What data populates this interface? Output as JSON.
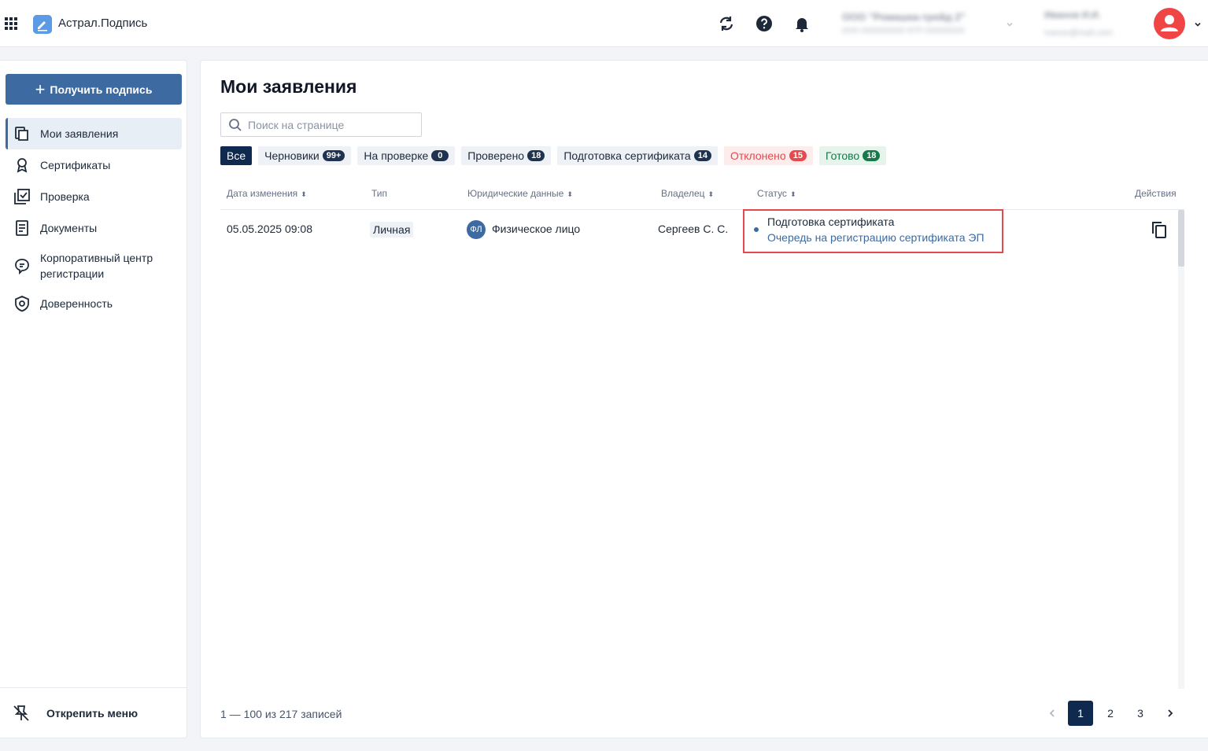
{
  "app": {
    "title": "Астрал.Подпись"
  },
  "header": {
    "org_name": "ООО \"Ромашка-трейд 2\"",
    "org_details": "ИНН 0000000000 КПП 000000000",
    "user_name": "Иванов И.И.",
    "user_email": "ivanov@mail.com",
    "icons": [
      "refresh-icon",
      "help-icon",
      "bell-icon"
    ]
  },
  "sidebar": {
    "get_sign_label": "Получить подпись",
    "items": [
      {
        "label": "Мои заявления",
        "icon": "documents-copy-icon",
        "active": true
      },
      {
        "label": "Сертификаты",
        "icon": "certificate-icon",
        "active": false
      },
      {
        "label": "Проверка",
        "icon": "check-icon",
        "active": false
      },
      {
        "label": "Документы",
        "icon": "document-icon",
        "active": false
      },
      {
        "label": "Корпоративный центр регистрации",
        "icon": "chat-icon",
        "active": false
      },
      {
        "label": "Доверенность",
        "icon": "shield-icon",
        "active": false
      }
    ],
    "unpin_label": "Открепить меню"
  },
  "main": {
    "title": "Мои заявления",
    "search_placeholder": "Поиск на странице",
    "filters": [
      {
        "label": "Все",
        "count": null,
        "style": "active"
      },
      {
        "label": "Черновики",
        "count": "99+",
        "style": "default"
      },
      {
        "label": "На проверке",
        "count": "0",
        "style": "default"
      },
      {
        "label": "Проверено",
        "count": "18",
        "style": "default"
      },
      {
        "label": "Подготовка сертификата",
        "count": "14",
        "style": "default"
      },
      {
        "label": "Отклонено",
        "count": "15",
        "style": "red"
      },
      {
        "label": "Готово",
        "count": "18",
        "style": "green"
      }
    ],
    "columns": {
      "date": "Дата изменения",
      "type": "Тип",
      "legal": "Юридические данные",
      "owner": "Владелец",
      "status": "Статус",
      "actions": "Действия"
    },
    "rows": [
      {
        "date": "05.05.2025 09:08",
        "type": "Личная",
        "legal_badge": "ФЛ",
        "legal": "Физическое лицо",
        "owner": "Сергеев С. С.",
        "status": "Подготовка сертификата",
        "status_detail": "Очередь на регистрацию сертификата ЭП"
      }
    ],
    "records_summary": "1 — 100 из 217 записей",
    "pages": [
      "1",
      "2",
      "3"
    ],
    "current_page": "1"
  },
  "colors": {
    "primary": "#3d6aa0",
    "dark": "#0f2a4e",
    "danger": "#e5484d",
    "success": "#16794a",
    "avatar": "#ef4545"
  }
}
